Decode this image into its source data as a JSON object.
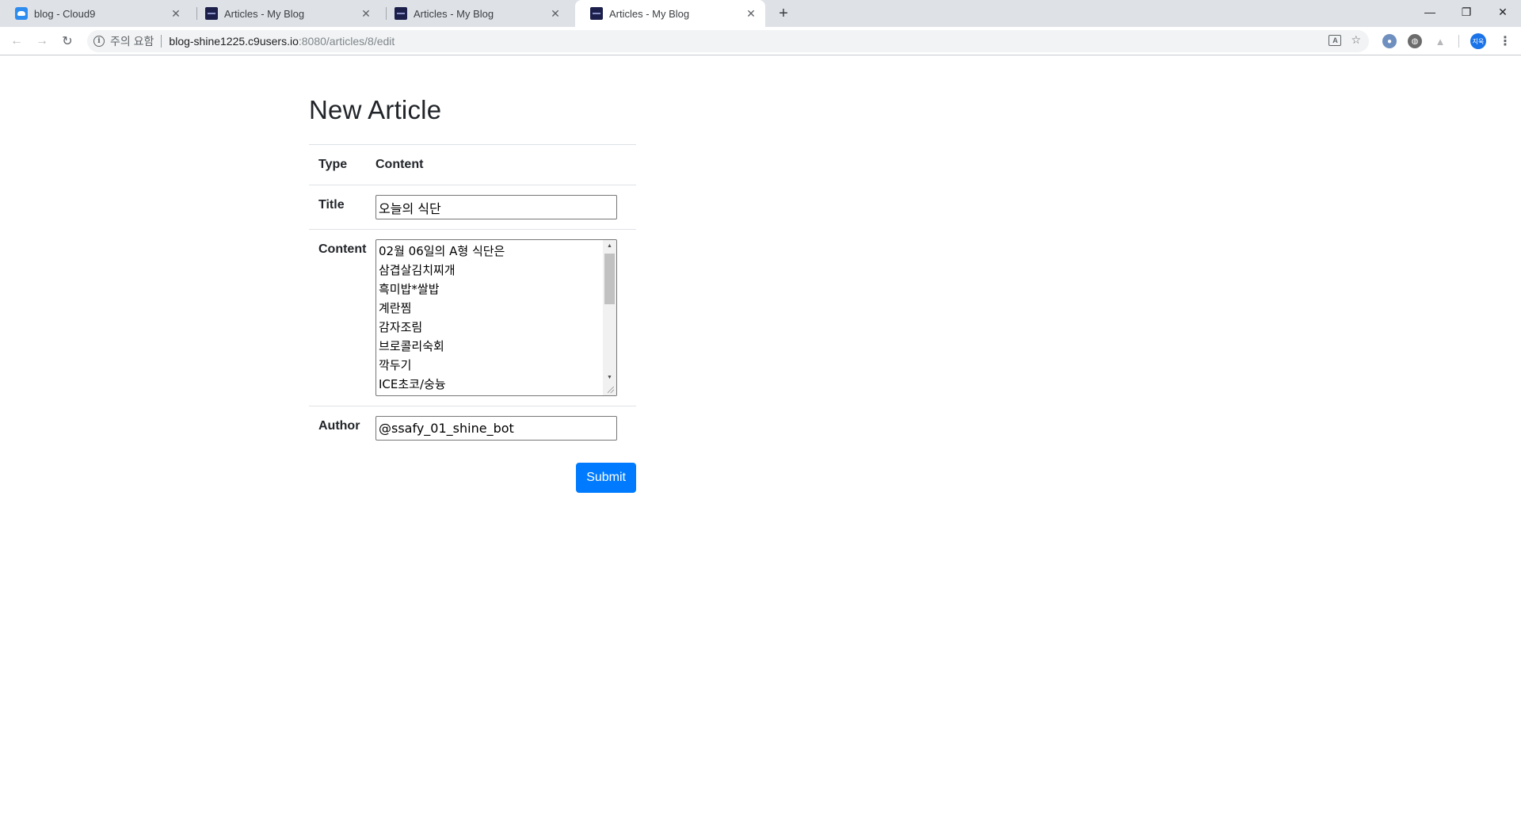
{
  "browser": {
    "tabs": [
      {
        "title": "blog - Cloud9",
        "favicon": "cloud9-icon",
        "active": false
      },
      {
        "title": "Articles - My Blog",
        "favicon": "blog-favicon-icon",
        "active": false
      },
      {
        "title": "Articles - My Blog",
        "favicon": "blog-favicon-icon",
        "active": false
      },
      {
        "title": "Articles - My Blog",
        "favicon": "blog-favicon-icon",
        "active": true
      }
    ],
    "address": {
      "security_label": "주의 요함",
      "host": "blog-shine1225.c9users.io",
      "path": ":8080/articles/8/edit"
    },
    "profile_initials": "지욱"
  },
  "page": {
    "title": "New Article",
    "table": {
      "header": {
        "col1": "Type",
        "col2": "Content"
      },
      "title_label": "Title",
      "title_value": "오늘의 식단",
      "content_label": "Content",
      "content_lines": [
        "02월 06일의 A형 식단은",
        "삼겹살김치찌개",
        "흑미밥*쌀밥",
        "계란찜",
        "감자조림",
        "브로콜리숙회",
        "깍두기",
        "ICE초코/숭늉"
      ],
      "author_label": "Author",
      "author_value": "@ssafy_01_shine_bot"
    },
    "submit_label": "Submit",
    "colors": {
      "primary": "#007bff",
      "text": "#212529",
      "border": "#dee2e6"
    }
  }
}
